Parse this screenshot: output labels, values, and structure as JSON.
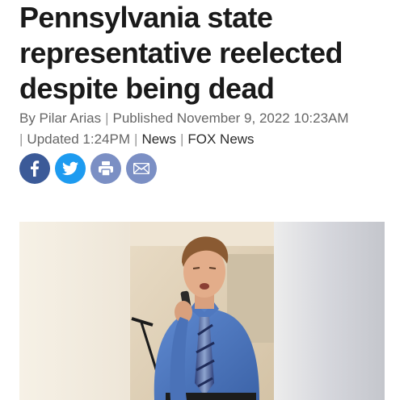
{
  "article": {
    "headline": "Pennsylvania state representative reelected despite being dead",
    "byline": {
      "author": "By Pilar Arias",
      "published": "Published November 9, 2022 10:23AM",
      "updated": "Updated 1:24PM",
      "category": "News",
      "source": "FOX News",
      "separator": "|"
    },
    "share": {
      "facebook_icon": "facebook-icon",
      "twitter_icon": "twitter-icon",
      "print_icon": "print-icon",
      "email_icon": "email-icon"
    }
  },
  "colors": {
    "facebook": "#3b5a98",
    "twitter": "#1d9bf0",
    "print": "#7b8fc4",
    "email": "#7b8fc4",
    "link": "#2b2b2b"
  }
}
